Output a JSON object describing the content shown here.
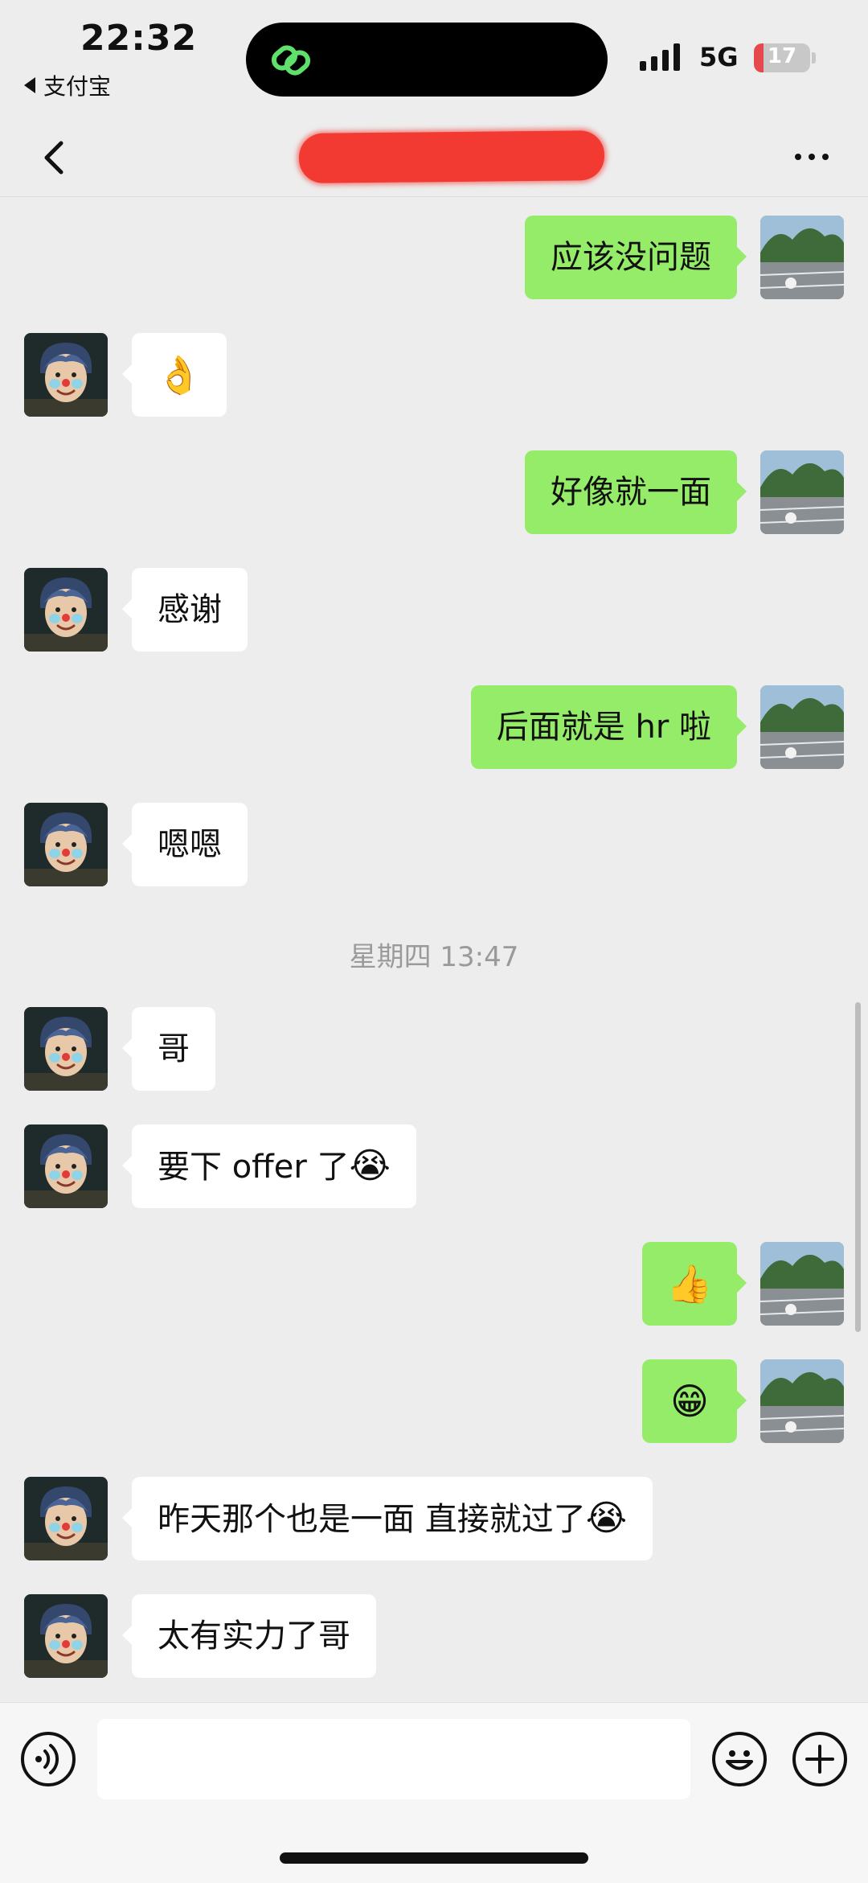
{
  "status_bar": {
    "time": "22:32",
    "back_app": "支付宝",
    "network": "5G",
    "battery": "17",
    "battery_level": 0.17
  },
  "nav": {
    "back_icon": "chevron-left-icon",
    "more_icon": "more-horizontal-icon"
  },
  "messages": [
    {
      "side": "out",
      "text": "应该没问题"
    },
    {
      "side": "in",
      "text": "👌"
    },
    {
      "side": "out",
      "text": "好像就一面"
    },
    {
      "side": "in",
      "text": "感谢"
    },
    {
      "side": "out",
      "text": "后面就是 hr 啦"
    },
    {
      "side": "in",
      "text": "嗯嗯"
    },
    {
      "side": "in",
      "text": "哥"
    },
    {
      "side": "in",
      "text": "要下 offer 了",
      "emoji": "😭"
    },
    {
      "side": "out",
      "text": "👍"
    },
    {
      "side": "out",
      "text": "😁"
    },
    {
      "side": "in",
      "text": "昨天那个也是一面  直接就过了",
      "emoji": "😭"
    },
    {
      "side": "in",
      "text": "太有实力了哥"
    }
  ],
  "timestamp": "星期四 13:47",
  "input_bar": {
    "placeholder": "",
    "voice_icon": "voice-icon",
    "emoji_icon": "emoji-icon",
    "plus_icon": "plus-icon"
  },
  "colors": {
    "background": "#ededed",
    "outgoing_bubble": "#95ec69",
    "incoming_bubble": "#ffffff",
    "redaction": "#f23a33"
  }
}
